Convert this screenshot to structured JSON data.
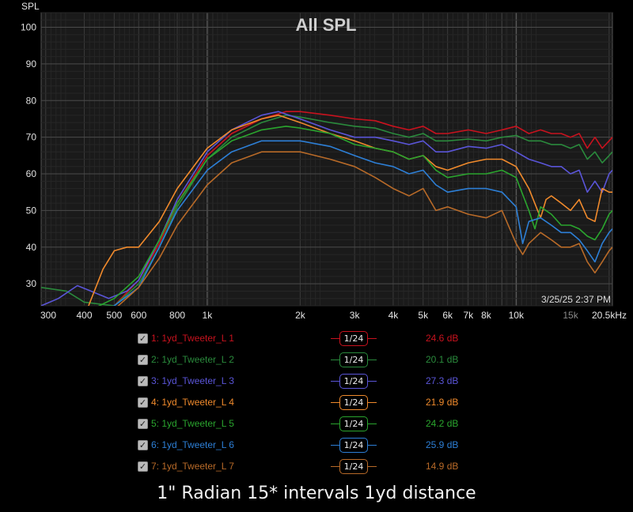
{
  "chart_data": {
    "type": "line",
    "title": "All SPL",
    "ylabel": "SPL",
    "xlabel": "",
    "x_scale": "log",
    "xlim": [
      290,
      20500
    ],
    "ylim": [
      24,
      104
    ],
    "yticks": [
      30,
      40,
      50,
      60,
      70,
      80,
      90,
      100
    ],
    "xticks": [
      {
        "value": 300,
        "label": "300"
      },
      {
        "value": 400,
        "label": "400"
      },
      {
        "value": 500,
        "label": "500"
      },
      {
        "value": 600,
        "label": "600"
      },
      {
        "value": 800,
        "label": "800"
      },
      {
        "value": 1000,
        "label": "1k"
      },
      {
        "value": 2000,
        "label": "2k"
      },
      {
        "value": 3000,
        "label": "3k"
      },
      {
        "value": 4000,
        "label": "4k"
      },
      {
        "value": 5000,
        "label": "5k"
      },
      {
        "value": 6000,
        "label": "6k"
      },
      {
        "value": 7000,
        "label": "7k"
      },
      {
        "value": 8000,
        "label": "8k"
      },
      {
        "value": 10000,
        "label": "10k"
      },
      {
        "value": 15000,
        "label": "15k",
        "dim": true
      },
      {
        "value": 20500,
        "label": "20.5kHz"
      }
    ],
    "grid": true,
    "timestamp": "3/25/25 2:37 PM",
    "series": [
      {
        "name": "1: 1yd_Tweeter_L 1",
        "color": "#c8121e",
        "smoothing": "1/24",
        "level": "24.6 dB",
        "points": [
          [
            290,
            22
          ],
          [
            400,
            21
          ],
          [
            500,
            24
          ],
          [
            600,
            31
          ],
          [
            700,
            41
          ],
          [
            800,
            52
          ],
          [
            1000,
            65
          ],
          [
            1200,
            71
          ],
          [
            1500,
            75
          ],
          [
            1800,
            77
          ],
          [
            2000,
            77
          ],
          [
            2500,
            76
          ],
          [
            3000,
            75
          ],
          [
            3500,
            74.5
          ],
          [
            4000,
            73
          ],
          [
            4500,
            72
          ],
          [
            5000,
            73
          ],
          [
            5500,
            71
          ],
          [
            6000,
            71
          ],
          [
            7000,
            72
          ],
          [
            8000,
            71
          ],
          [
            9000,
            72
          ],
          [
            10000,
            73
          ],
          [
            11000,
            71
          ],
          [
            12000,
            72
          ],
          [
            13000,
            71
          ],
          [
            14000,
            71
          ],
          [
            15000,
            70
          ],
          [
            16000,
            71
          ],
          [
            17000,
            67
          ],
          [
            18000,
            70
          ],
          [
            19000,
            67
          ],
          [
            20000,
            69
          ],
          [
            20500,
            70
          ]
        ]
      },
      {
        "name": "2: 1yd_Tweeter_L 2",
        "color": "#2a8a3c",
        "smoothing": "1/24",
        "level": "20.1 dB",
        "points": [
          [
            290,
            29
          ],
          [
            350,
            28
          ],
          [
            400,
            25
          ],
          [
            500,
            24
          ],
          [
            600,
            30
          ],
          [
            700,
            40
          ],
          [
            800,
            51
          ],
          [
            1000,
            64
          ],
          [
            1200,
            70
          ],
          [
            1500,
            74
          ],
          [
            1800,
            76
          ],
          [
            2000,
            75.5
          ],
          [
            2500,
            74
          ],
          [
            3000,
            73
          ],
          [
            3500,
            72.5
          ],
          [
            4000,
            71
          ],
          [
            4500,
            70
          ],
          [
            5000,
            71
          ],
          [
            5500,
            69
          ],
          [
            6000,
            69
          ],
          [
            7000,
            69.5
          ],
          [
            8000,
            69
          ],
          [
            9000,
            70
          ],
          [
            10000,
            70.5
          ],
          [
            11000,
            69
          ],
          [
            12000,
            69
          ],
          [
            13000,
            68
          ],
          [
            14000,
            68
          ],
          [
            15000,
            67
          ],
          [
            16000,
            68
          ],
          [
            17000,
            64
          ],
          [
            18000,
            66
          ],
          [
            19000,
            63
          ],
          [
            20000,
            65
          ],
          [
            20500,
            66
          ]
        ]
      },
      {
        "name": "3: 1yd_Tweeter_L 3",
        "color": "#5a55d8",
        "smoothing": "1/24",
        "level": "27.3 dB",
        "points": [
          [
            290,
            24
          ],
          [
            330,
            26
          ],
          [
            380,
            29.5
          ],
          [
            420,
            28
          ],
          [
            480,
            26
          ],
          [
            550,
            28
          ],
          [
            600,
            31
          ],
          [
            700,
            42
          ],
          [
            800,
            53
          ],
          [
            1000,
            66
          ],
          [
            1200,
            72
          ],
          [
            1500,
            76
          ],
          [
            1700,
            77
          ],
          [
            2000,
            75
          ],
          [
            2500,
            72
          ],
          [
            3000,
            70
          ],
          [
            3500,
            70
          ],
          [
            4000,
            69
          ],
          [
            4500,
            68
          ],
          [
            5000,
            69
          ],
          [
            5500,
            66
          ],
          [
            6000,
            66
          ],
          [
            7000,
            67.5
          ],
          [
            8000,
            67
          ],
          [
            9000,
            68
          ],
          [
            10000,
            66
          ],
          [
            11000,
            64
          ],
          [
            12000,
            63
          ],
          [
            13000,
            62
          ],
          [
            14000,
            62
          ],
          [
            15000,
            60
          ],
          [
            16000,
            61
          ],
          [
            17000,
            55
          ],
          [
            18000,
            58
          ],
          [
            19000,
            55
          ],
          [
            20000,
            60
          ],
          [
            20500,
            61
          ]
        ]
      },
      {
        "name": "4: 1yd_Tweeter_L 4",
        "color": "#f08a2c",
        "smoothing": "1/24",
        "level": "21.9 dB",
        "points": [
          [
            290,
            20
          ],
          [
            400,
            21
          ],
          [
            460,
            34
          ],
          [
            500,
            39
          ],
          [
            550,
            40
          ],
          [
            600,
            40
          ],
          [
            700,
            47
          ],
          [
            800,
            56
          ],
          [
            1000,
            67
          ],
          [
            1200,
            72
          ],
          [
            1500,
            75
          ],
          [
            1700,
            76
          ],
          [
            2000,
            74
          ],
          [
            2500,
            71
          ],
          [
            3000,
            69
          ],
          [
            3500,
            67
          ],
          [
            4000,
            66
          ],
          [
            4500,
            64
          ],
          [
            5000,
            65
          ],
          [
            5500,
            62
          ],
          [
            6000,
            61
          ],
          [
            7000,
            63
          ],
          [
            8000,
            64
          ],
          [
            9000,
            64
          ],
          [
            10000,
            62
          ],
          [
            11000,
            56
          ],
          [
            12000,
            48
          ],
          [
            12500,
            53
          ],
          [
            13000,
            54
          ],
          [
            14000,
            52
          ],
          [
            15000,
            50
          ],
          [
            16000,
            53
          ],
          [
            17000,
            48
          ],
          [
            18000,
            47
          ],
          [
            19000,
            56
          ],
          [
            20000,
            55
          ],
          [
            20500,
            55
          ]
        ]
      },
      {
        "name": "5: 1yd_Tweeter_L 5",
        "color": "#2aa52e",
        "smoothing": "1/24",
        "level": "24.2 dB",
        "points": [
          [
            290,
            21
          ],
          [
            400,
            22
          ],
          [
            500,
            26
          ],
          [
            600,
            32
          ],
          [
            700,
            42
          ],
          [
            800,
            52
          ],
          [
            1000,
            64
          ],
          [
            1200,
            69
          ],
          [
            1500,
            72
          ],
          [
            1800,
            73
          ],
          [
            2000,
            72.5
          ],
          [
            2500,
            71
          ],
          [
            3000,
            68
          ],
          [
            3500,
            67
          ],
          [
            4000,
            66
          ],
          [
            4500,
            64
          ],
          [
            5000,
            65
          ],
          [
            5500,
            61
          ],
          [
            6000,
            59
          ],
          [
            7000,
            60
          ],
          [
            8000,
            60
          ],
          [
            9000,
            61
          ],
          [
            10000,
            59
          ],
          [
            11000,
            50
          ],
          [
            11500,
            45
          ],
          [
            12000,
            51
          ],
          [
            13000,
            49
          ],
          [
            14000,
            46
          ],
          [
            15000,
            46
          ],
          [
            16000,
            45
          ],
          [
            17000,
            43
          ],
          [
            18000,
            42
          ],
          [
            19000,
            45
          ],
          [
            20000,
            49
          ],
          [
            20500,
            50
          ]
        ]
      },
      {
        "name": "6: 1yd_Tweeter_L 6",
        "color": "#2d7fd6",
        "smoothing": "1/24",
        "level": "25.9 dB",
        "points": [
          [
            290,
            20
          ],
          [
            400,
            21
          ],
          [
            500,
            24
          ],
          [
            600,
            29
          ],
          [
            700,
            40
          ],
          [
            800,
            50
          ],
          [
            1000,
            61
          ],
          [
            1200,
            66
          ],
          [
            1500,
            69
          ],
          [
            1800,
            69
          ],
          [
            2000,
            69
          ],
          [
            2500,
            67.5
          ],
          [
            3000,
            65
          ],
          [
            3500,
            63
          ],
          [
            4000,
            62
          ],
          [
            4500,
            60
          ],
          [
            5000,
            61
          ],
          [
            5500,
            57
          ],
          [
            6000,
            55
          ],
          [
            7000,
            56
          ],
          [
            8000,
            56
          ],
          [
            9000,
            55
          ],
          [
            10000,
            51
          ],
          [
            10500,
            41
          ],
          [
            11000,
            47
          ],
          [
            12000,
            48
          ],
          [
            13000,
            46
          ],
          [
            14000,
            44
          ],
          [
            15000,
            44
          ],
          [
            16000,
            42
          ],
          [
            17000,
            39
          ],
          [
            18000,
            36
          ],
          [
            19000,
            41
          ],
          [
            20000,
            44
          ],
          [
            20500,
            45
          ]
        ]
      },
      {
        "name": "7: 1yd_Tweeter_L 7",
        "color": "#b86a28",
        "smoothing": "1/24",
        "level": "14.9 dB",
        "points": [
          [
            290,
            20
          ],
          [
            400,
            21
          ],
          [
            500,
            23
          ],
          [
            600,
            29
          ],
          [
            700,
            37
          ],
          [
            800,
            46
          ],
          [
            1000,
            57
          ],
          [
            1200,
            63
          ],
          [
            1500,
            66
          ],
          [
            1800,
            66
          ],
          [
            2000,
            66
          ],
          [
            2500,
            64
          ],
          [
            3000,
            62
          ],
          [
            3500,
            59
          ],
          [
            4000,
            56
          ],
          [
            4500,
            54
          ],
          [
            5000,
            56
          ],
          [
            5500,
            50
          ],
          [
            6000,
            51
          ],
          [
            7000,
            49
          ],
          [
            8000,
            48
          ],
          [
            9000,
            50
          ],
          [
            10000,
            41
          ],
          [
            10500,
            38
          ],
          [
            11000,
            41
          ],
          [
            12000,
            44
          ],
          [
            13000,
            42
          ],
          [
            14000,
            40
          ],
          [
            15000,
            40
          ],
          [
            16000,
            41
          ],
          [
            17000,
            36
          ],
          [
            18000,
            33
          ],
          [
            19000,
            36
          ],
          [
            20000,
            39
          ],
          [
            20500,
            40
          ]
        ]
      }
    ]
  },
  "caption": "1\" Radian 15* intervals 1yd distance"
}
